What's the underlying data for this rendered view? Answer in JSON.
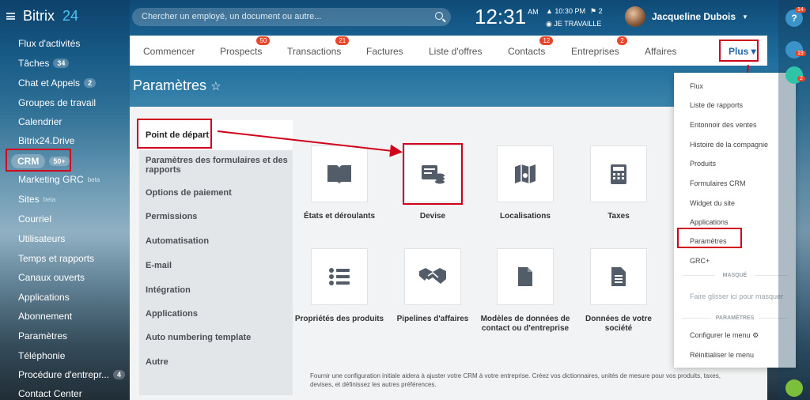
{
  "app": {
    "logo_text": "Bitrix",
    "logo_num": "24"
  },
  "sidebar": {
    "items": [
      {
        "label": "Flux d'activités"
      },
      {
        "label": "Tâches",
        "count": "34"
      },
      {
        "label": "Chat et Appels",
        "count": "2"
      },
      {
        "label": "Groupes de travail"
      },
      {
        "label": "Calendrier"
      },
      {
        "label": "Bitrix24.Drive"
      },
      {
        "label": "CRM",
        "count": "50+"
      },
      {
        "label": "Marketing GRC",
        "sup": "beta"
      },
      {
        "label": "Sites",
        "sup": "beta"
      },
      {
        "label": "Courriel"
      },
      {
        "label": "Utilisateurs"
      },
      {
        "label": "Temps et rapports"
      },
      {
        "label": "Canaux ouverts"
      },
      {
        "label": "Applications"
      },
      {
        "label": "Abonnement"
      },
      {
        "label": "Paramètres"
      },
      {
        "label": "Téléphonie"
      },
      {
        "label": "Procédure d'entrepr...",
        "count": "4"
      },
      {
        "label": "Contact Center"
      }
    ]
  },
  "header": {
    "search_placeholder": "Chercher un employé, un document ou autre...",
    "time": "12:31",
    "ampm": "AM",
    "alarm": "10:30 PM",
    "flags": "2",
    "status": "JE TRAVAILLE",
    "user_name": "Jacqueline Dubois"
  },
  "tabs": [
    {
      "label": "Commencer"
    },
    {
      "label": "Prospects",
      "badge": "50"
    },
    {
      "label": "Transactions",
      "badge": "21"
    },
    {
      "label": "Factures"
    },
    {
      "label": "Liste d'offres"
    },
    {
      "label": "Contacts",
      "badge": "12"
    },
    {
      "label": "Entreprises",
      "badge": "2"
    },
    {
      "label": "Affaires"
    },
    {
      "label": "Plus"
    }
  ],
  "page": {
    "title": "Paramètres"
  },
  "settings_menu": [
    {
      "label": "Point de départ"
    },
    {
      "label": "Paramètres des formulaires et des rapports"
    },
    {
      "label": "Options de paiement"
    },
    {
      "label": "Permissions"
    },
    {
      "label": "Automatisation"
    },
    {
      "label": "E-mail"
    },
    {
      "label": "Intégration"
    },
    {
      "label": "Applications"
    },
    {
      "label": "Auto numbering template"
    },
    {
      "label": "Autre"
    }
  ],
  "tiles": [
    {
      "label": "États et déroulants",
      "icon": "book-icon"
    },
    {
      "label": "Devise",
      "icon": "currency-icon"
    },
    {
      "label": "Localisations",
      "icon": "map-icon"
    },
    {
      "label": "Taxes",
      "icon": "calculator-icon"
    },
    {
      "label": "Propriétés des produits",
      "icon": "list-icon"
    },
    {
      "label": "Pipelines d'affaires",
      "icon": "handshake-icon"
    },
    {
      "label": "Modèles de données de contact ou d'entreprise",
      "icon": "document-icon"
    },
    {
      "label": "Données de votre société",
      "icon": "document-lines-icon"
    }
  ],
  "description": "Fournir une configuration initiale aidera à ajuster votre CRM à votre entreprise. Créez vos dictionnaires, unités de mesure pour vos produits, taxes, devises, et définissez les autres préférences.",
  "dropdown": {
    "items": [
      "Flux",
      "Liste de rapports",
      "Entonnoir des ventes",
      "Histoire de la compagnie",
      "Produits",
      "Formulaires CRM",
      "Widget du site",
      "Applications",
      "Paramètres",
      "GRC+"
    ],
    "hidden_title": "MASQUÉ",
    "hidden_hint": "Faire glisser ici pour masquer",
    "settings_title": "PARAMÈTRES",
    "configure": "Configurer le menu",
    "reset": "Réinitialiser le menu"
  },
  "rail": {
    "help_badge": "14",
    "notif_badge": "19",
    "chat_badge": "2",
    "help_glyph": "?"
  },
  "colors": {
    "accent": "#2067b0",
    "annotation": "#d0021b",
    "badge": "#e8462a"
  }
}
